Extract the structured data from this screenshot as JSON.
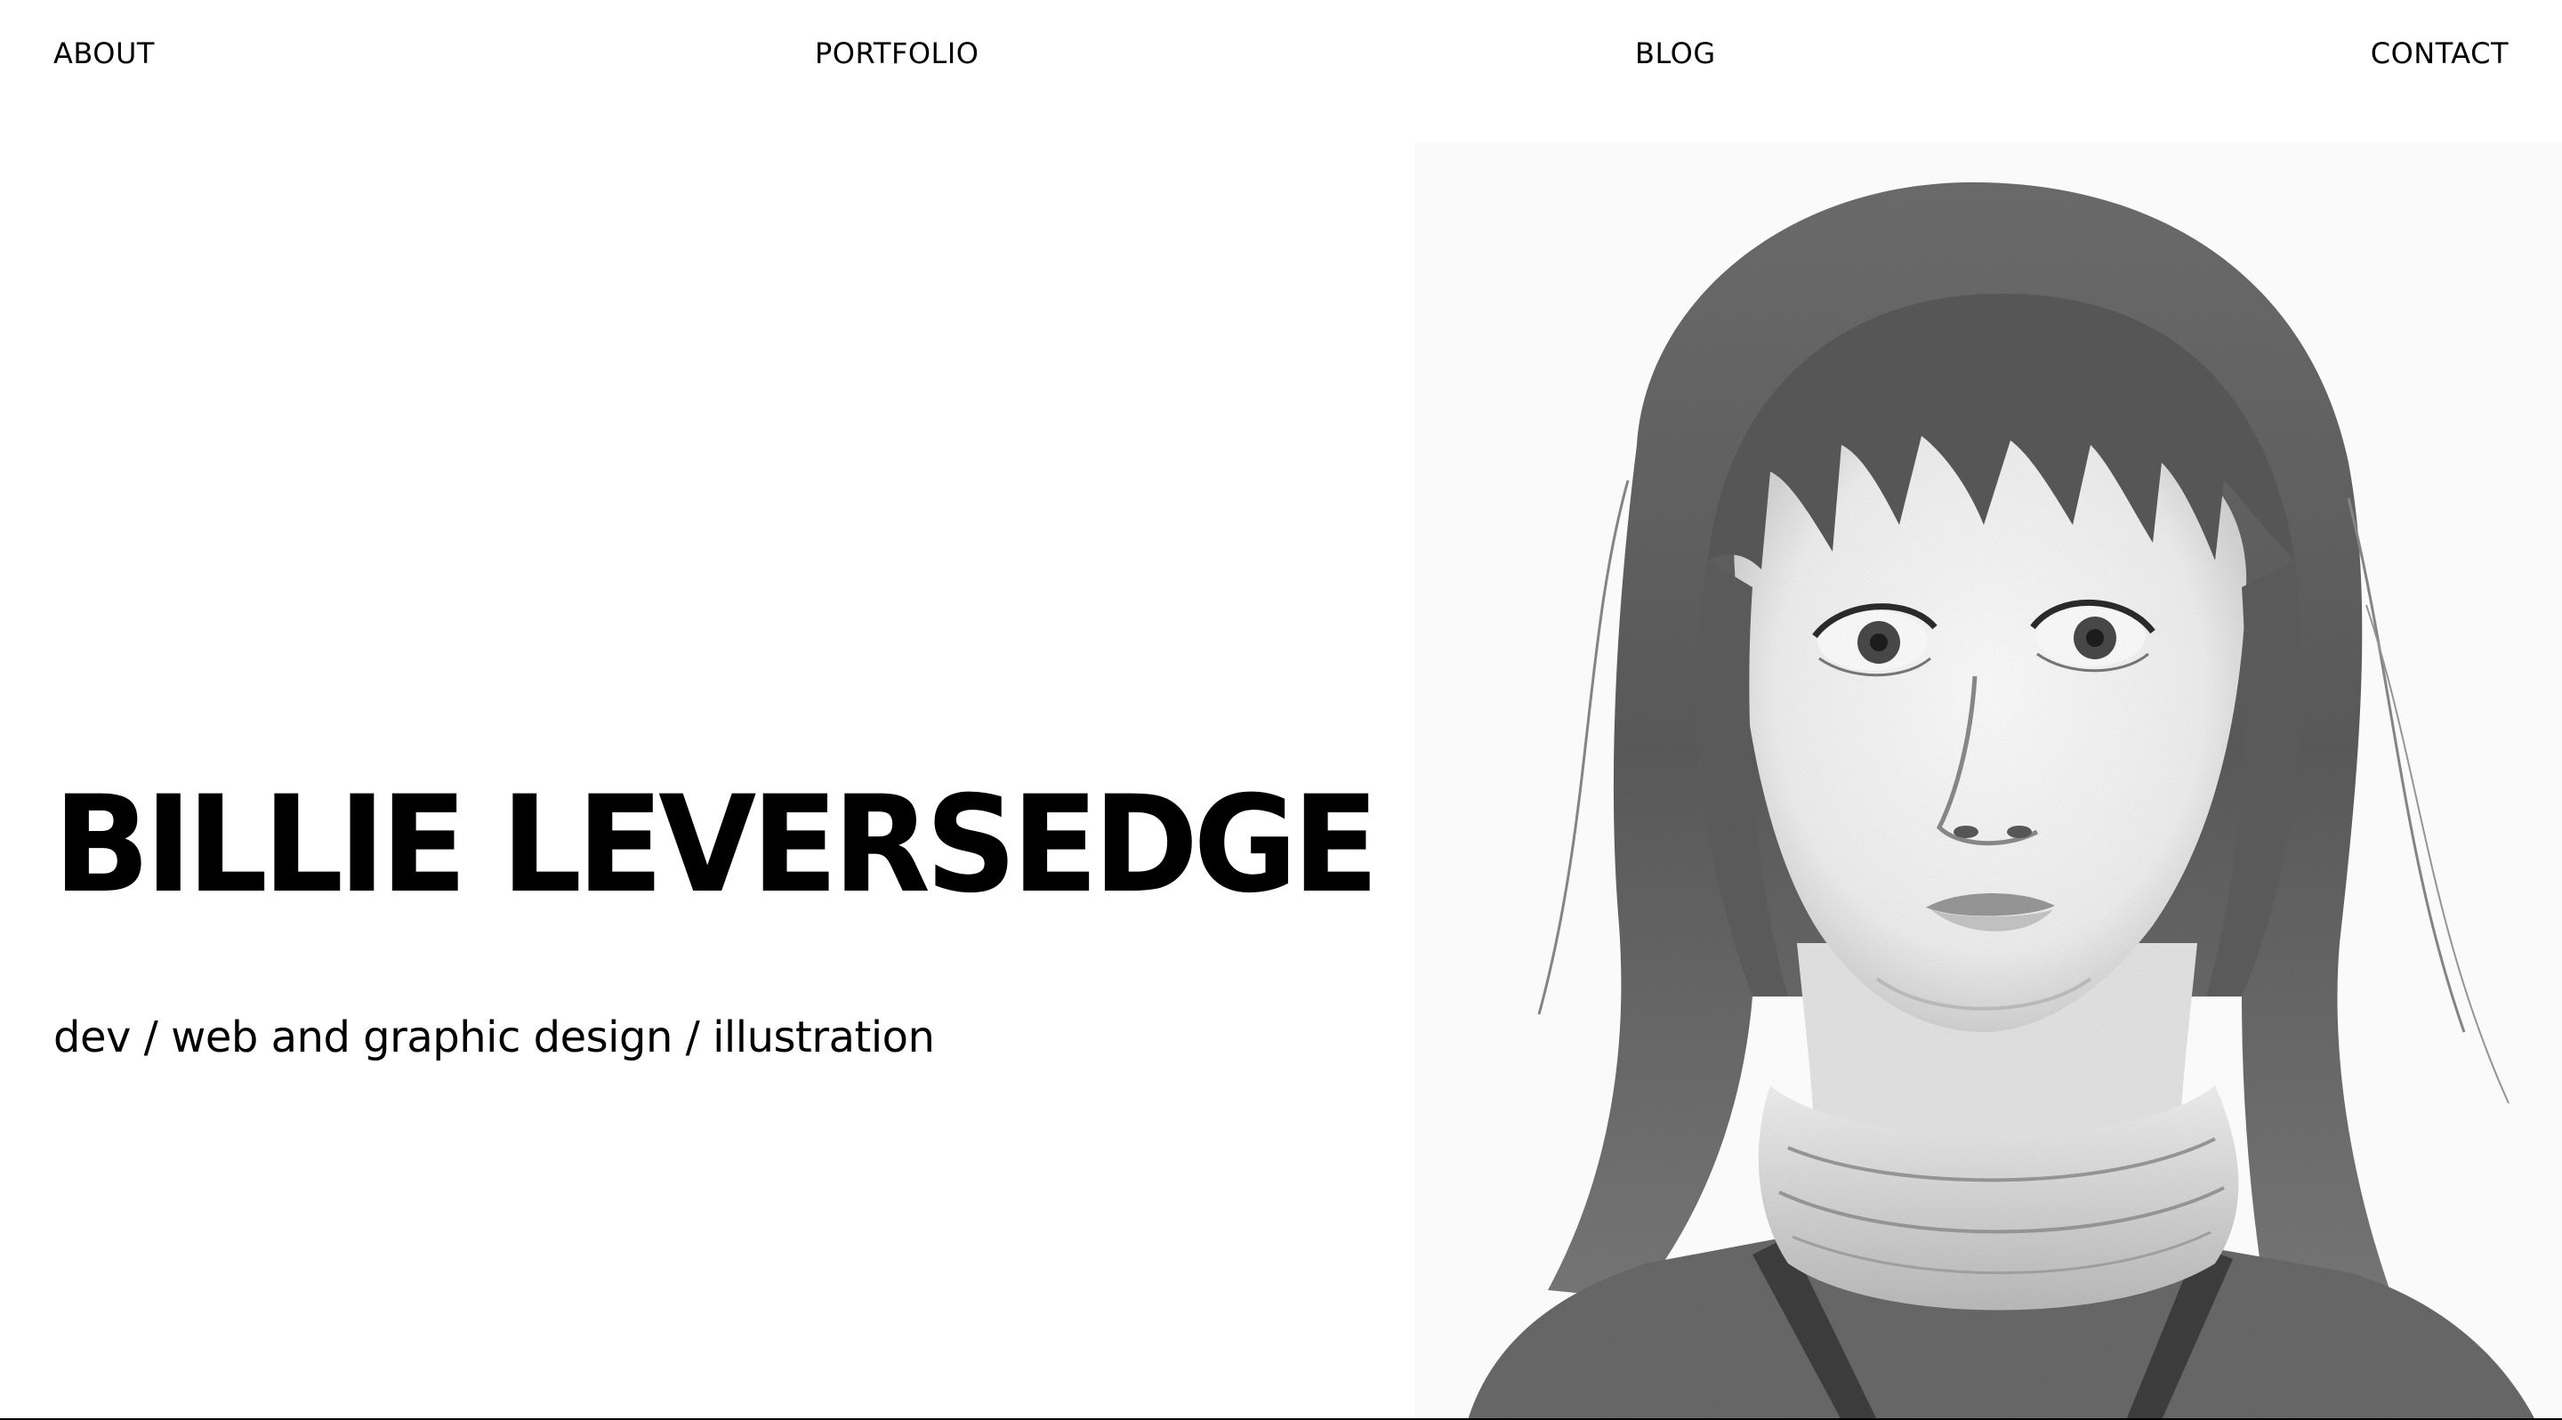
{
  "nav": {
    "items": [
      {
        "label": "ABOUT"
      },
      {
        "label": "PORTFOLIO"
      },
      {
        "label": "BLOG"
      },
      {
        "label": "CONTACT"
      }
    ]
  },
  "hero": {
    "name": "BILLIE LEVERSEDGE",
    "tagline": "dev / web and graphic design / illustration",
    "image_alt_icon": "pencil-portrait-illustration"
  },
  "colors": {
    "background": "#ffffff",
    "text": "#000000",
    "sketch": "#5a5a5a"
  }
}
